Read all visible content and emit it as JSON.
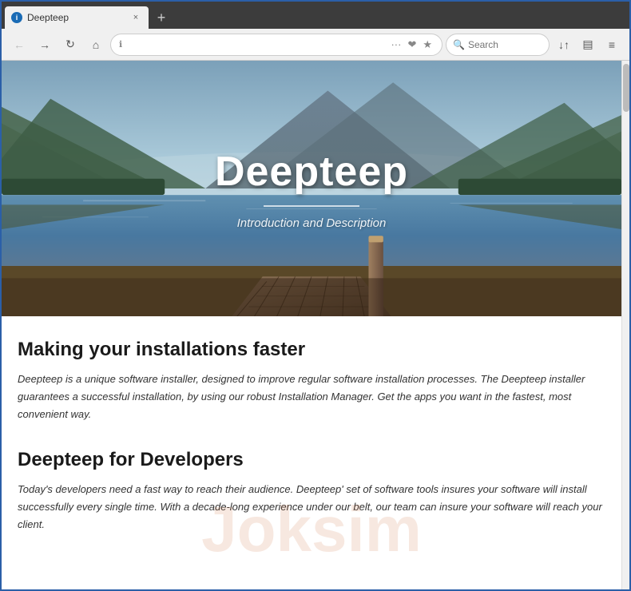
{
  "browser": {
    "tab": {
      "favicon_text": "i",
      "title": "Deepteep",
      "close_label": "×"
    },
    "new_tab_label": "+",
    "nav": {
      "back_label": "←",
      "forward_label": "→",
      "refresh_label": "↻",
      "home_label": "⌂",
      "address_text": "",
      "address_icon": "ℹ",
      "address_actions": [
        "···",
        "❤",
        "★"
      ],
      "search_placeholder": "Search",
      "reader_icon": "▤",
      "tabs_icon": "⧉",
      "menu_icon": "≡",
      "bookmarks_icon": "↓↑"
    }
  },
  "hero": {
    "title": "Deepteep",
    "underline": true,
    "subtitle": "Introduction and Description"
  },
  "sections": [
    {
      "id": "installations",
      "title": "Making your installations faster",
      "text": "Deepteep is a unique software installer, designed to improve regular software installation processes. The Deepteep installer guarantees a successful installation, by using our robust Installation Manager. Get the apps you want in the fastest, most convenient way."
    },
    {
      "id": "developers",
      "title": "Deepteep for Developers",
      "text": "Today's developers need a fast way to reach their audience. Deepteep' set of software tools insures your software will install successfully every single time. With a decade-long experience under our belt, our team can insure your software will reach your client."
    }
  ],
  "watermark": {
    "text": "Joksim"
  },
  "colors": {
    "browser_frame": "#2b5fa8",
    "tab_bar_bg": "#3c3c3c",
    "nav_bar_bg": "#f0f0f0",
    "hero_title_color": "#ffffff",
    "section_title_color": "#1a1a1a",
    "section_text_color": "#333333"
  }
}
